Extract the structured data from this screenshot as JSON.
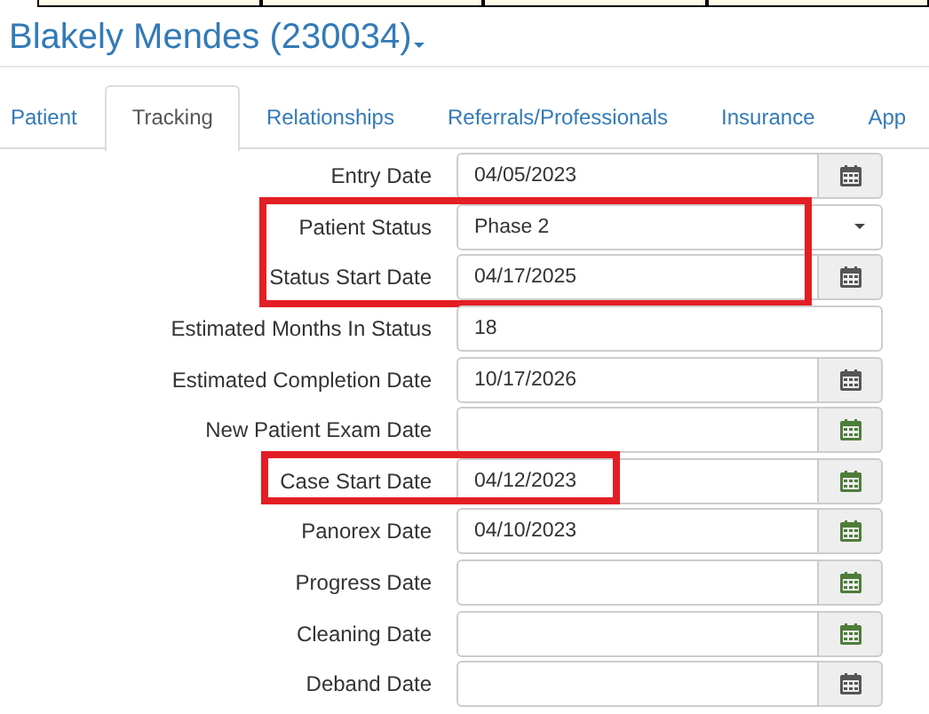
{
  "title": "Blakely Mendes (230034)",
  "tabs": [
    {
      "label": "Patient",
      "selected": false
    },
    {
      "label": "Tracking",
      "selected": true
    },
    {
      "label": "Relationships",
      "selected": false
    },
    {
      "label": "Referrals/Professionals",
      "selected": false
    },
    {
      "label": "Insurance",
      "selected": false
    },
    {
      "label": "App",
      "selected": false
    }
  ],
  "fields": [
    {
      "label": "Entry Date",
      "kind": "date",
      "value": "04/05/2023",
      "color": "#555555"
    },
    {
      "label": "Patient Status",
      "kind": "select",
      "value": "Phase 2",
      "highlighted": true
    },
    {
      "label": "Status Start Date",
      "kind": "date",
      "value": "04/17/2025",
      "color": "#555555",
      "highlighted": true
    },
    {
      "label": "Estimated Months In Status",
      "kind": "number",
      "value": "18"
    },
    {
      "label": "Estimated Completion Date",
      "kind": "date",
      "value": "10/17/2026",
      "color": "#555555"
    },
    {
      "label": "New Patient Exam Date",
      "kind": "date",
      "color": "#4e7d3a"
    },
    {
      "label": "Case Start Date",
      "kind": "date",
      "value": "04/12/2023",
      "color": "#4e7d3a",
      "highlighted": true
    },
    {
      "label": "Panorex Date",
      "kind": "date",
      "value": "04/10/2023",
      "color": "#4e7d3a"
    },
    {
      "label": "Progress Date",
      "kind": "date",
      "color": "#4e7d3a"
    },
    {
      "label": "Cleaning Date",
      "kind": "date",
      "color": "#4e7d3a"
    },
    {
      "label": "Deband Date",
      "kind": "date",
      "color": "#555555"
    }
  ]
}
